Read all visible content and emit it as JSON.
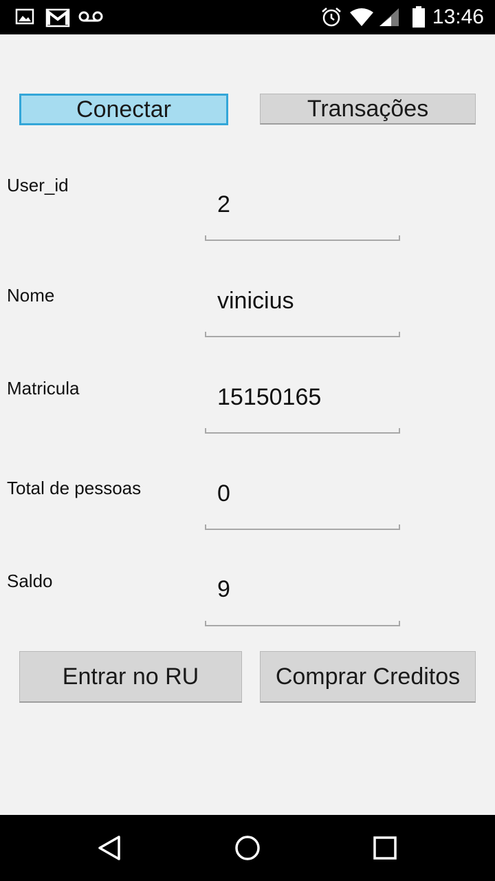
{
  "status_bar": {
    "time": "13:46",
    "icons": [
      "image-icon",
      "gmail-icon",
      "voicemail-icon",
      "alarm-icon",
      "wifi-icon",
      "cell-signal-icon",
      "battery-icon"
    ]
  },
  "toolbar": {
    "connect_label": "Conectar",
    "transactions_label": "Transações"
  },
  "fields": [
    {
      "label": "User_id",
      "value": "2"
    },
    {
      "label": "Nome",
      "value": "vinicius"
    },
    {
      "label": "Matricula",
      "value": "15150165"
    },
    {
      "label": "Total de pessoas",
      "value": "0"
    },
    {
      "label": "Saldo",
      "value": "9"
    }
  ],
  "actions": {
    "enter_label": "Entrar no RU",
    "buy_label": "Comprar Creditos"
  },
  "colors": {
    "background": "#f2f2f2",
    "button": "#d6d6d6",
    "button_active": "#a6dcf0",
    "button_active_border": "#33a6d8",
    "system_bars": "#000000"
  },
  "nav_bar": {
    "icons": [
      "back-icon",
      "home-icon",
      "recents-icon"
    ]
  }
}
